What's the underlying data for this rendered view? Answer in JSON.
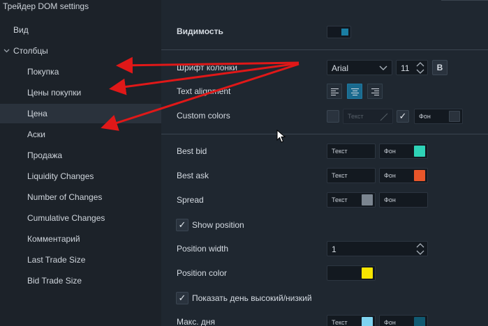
{
  "window": {
    "title": "Трейдер DOM settings"
  },
  "sidebar": {
    "items": [
      {
        "label": "Вид"
      },
      {
        "label": "Столбцы"
      },
      {
        "label": "Покупка"
      },
      {
        "label": "Цены покупки"
      },
      {
        "label": "Цена"
      },
      {
        "label": "Аски"
      },
      {
        "label": "Продажа"
      },
      {
        "label": "Liquidity Changes"
      },
      {
        "label": "Number of Changes"
      },
      {
        "label": "Cumulative Changes"
      },
      {
        "label": "Комментарий"
      },
      {
        "label": "Last Trade Size"
      },
      {
        "label": "Bid Trade Size"
      }
    ],
    "expander_icon": "chevron-down-icon"
  },
  "settings": {
    "visibility": {
      "label": "Видимость"
    },
    "font": {
      "label": "Шрифт колонки",
      "family": "Arial",
      "size": "11",
      "bold_label": "B"
    },
    "text_alignment": {
      "label": "Text alignment",
      "selected": "center"
    },
    "custom_colors": {
      "label": "Custom colors",
      "text_label": "Текст",
      "bg_label": "Фон",
      "text_checked": false,
      "bg_checked": true
    },
    "best_bid": {
      "label": "Best bid",
      "text_label": "Текст",
      "bg_label": "Фон",
      "bg_color": "#2ed3b7"
    },
    "best_ask": {
      "label": "Best ask",
      "text_label": "Текст",
      "bg_label": "Фон",
      "bg_color": "#e8562a"
    },
    "spread": {
      "label": "Spread",
      "text_label": "Текст",
      "bg_label": "Фон",
      "text_color": "#7b8590"
    },
    "show_position": {
      "label": "Show position",
      "checked": true
    },
    "position_width": {
      "label": "Position width",
      "value": "1"
    },
    "position_color": {
      "label": "Position color",
      "color": "#f6e500"
    },
    "show_day_high_low": {
      "label": "Показать день высокий/низкий",
      "checked": true
    },
    "day_max": {
      "label": "Макс. дня",
      "text_label": "Текст",
      "bg_label": "Фон",
      "text_color": "#7fd3f0",
      "bg_color": "#115a72"
    }
  },
  "colors": {
    "accent": "#1a7ea3",
    "annotation_arrow": "#e01818"
  },
  "checkmark": "✓"
}
